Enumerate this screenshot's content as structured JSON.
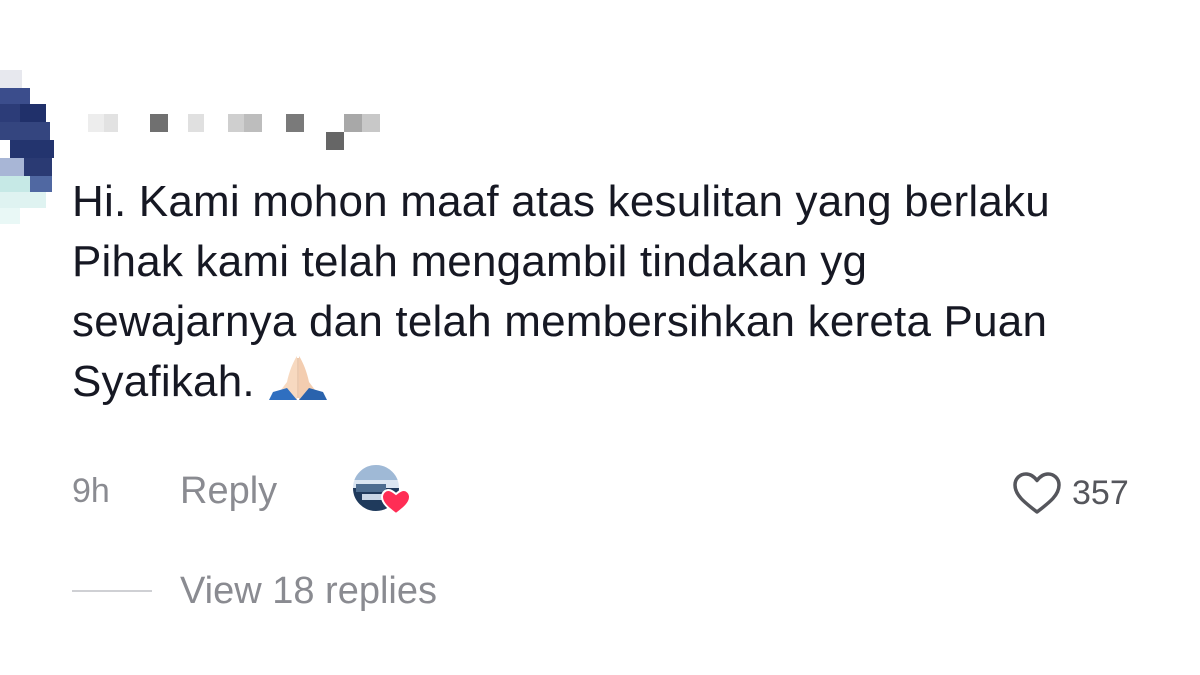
{
  "comment": {
    "lines": [
      "Hi. Kami mohon maaf atas kesulitan yang berlaku",
      "Pihak kami telah mengambil tindakan yg",
      "sewajarnya dan telah membersihkan kereta Puan",
      "Syafikah."
    ],
    "emoji_icon": "folded-hands-icon"
  },
  "meta": {
    "time": "9h",
    "reply_label": "Reply",
    "creator_like_icon": "creator-avatar-heart-icon",
    "like_count": "357",
    "like_icon": "heart-outline-icon",
    "heart_color": "#ff2d55"
  },
  "replies": {
    "label": "View 18 replies"
  }
}
